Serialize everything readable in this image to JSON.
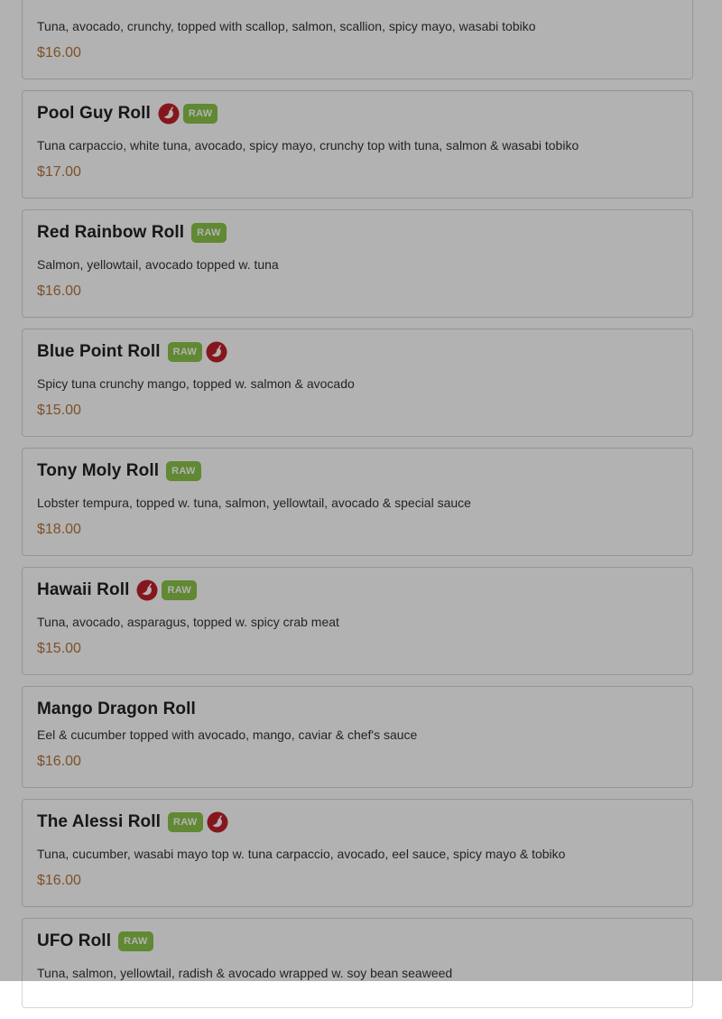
{
  "menu": {
    "badge_raw_label": "RAW",
    "items": [
      {
        "name": "",
        "description": "Tuna, avocado, crunchy, topped with scallop, salmon, scallion, spicy mayo, wasabi tobiko",
        "price": "$16.00",
        "badges": []
      },
      {
        "name": "Pool Guy Roll",
        "description": "Tuna carpaccio, white tuna, avocado, spicy mayo, crunchy top with tuna, salmon & wasabi tobiko",
        "price": "$17.00",
        "badges": [
          "spicy-icon",
          "raw-badge"
        ]
      },
      {
        "name": "Red Rainbow Roll",
        "description": "Salmon, yellowtail, avocado topped w. tuna",
        "price": "$16.00",
        "badges": [
          "raw-badge"
        ]
      },
      {
        "name": "Blue Point Roll",
        "description": "Spicy tuna crunchy mango, topped w. salmon & avocado",
        "price": "$15.00",
        "badges": [
          "raw-badge",
          "spicy-icon"
        ]
      },
      {
        "name": "Tony Moly Roll",
        "description": "Lobster tempura, topped w. tuna, salmon, yellowtail, avocado & special sauce",
        "price": "$18.00",
        "badges": [
          "raw-badge"
        ]
      },
      {
        "name": "Hawaii Roll",
        "description": "Tuna, avocado, asparagus, topped w. spicy crab meat",
        "price": "$15.00",
        "badges": [
          "spicy-icon",
          "raw-badge"
        ]
      },
      {
        "name": "Mango Dragon Roll",
        "description": "Eel & cucumber topped with avocado, mango, caviar & chef's sauce",
        "price": "$16.00",
        "badges": []
      },
      {
        "name": "The Alessi Roll",
        "description": "Tuna, cucumber, wasabi mayo top w. tuna carpaccio, avocado, eel sauce, spicy mayo & tobiko",
        "price": "$16.00",
        "badges": [
          "raw-badge",
          "spicy-icon"
        ]
      },
      {
        "name": "UFO Roll",
        "description": "Tuna, salmon, yellowtail, radish & avocado wrapped w. soy bean seaweed",
        "price": "",
        "badges": [
          "raw-badge"
        ]
      }
    ]
  },
  "colors": {
    "raw_badge": "#8bc34a",
    "spicy_icon": "#c0202a",
    "price": "#b3743a",
    "overlay": "rgba(0,0,0,0.3)"
  }
}
